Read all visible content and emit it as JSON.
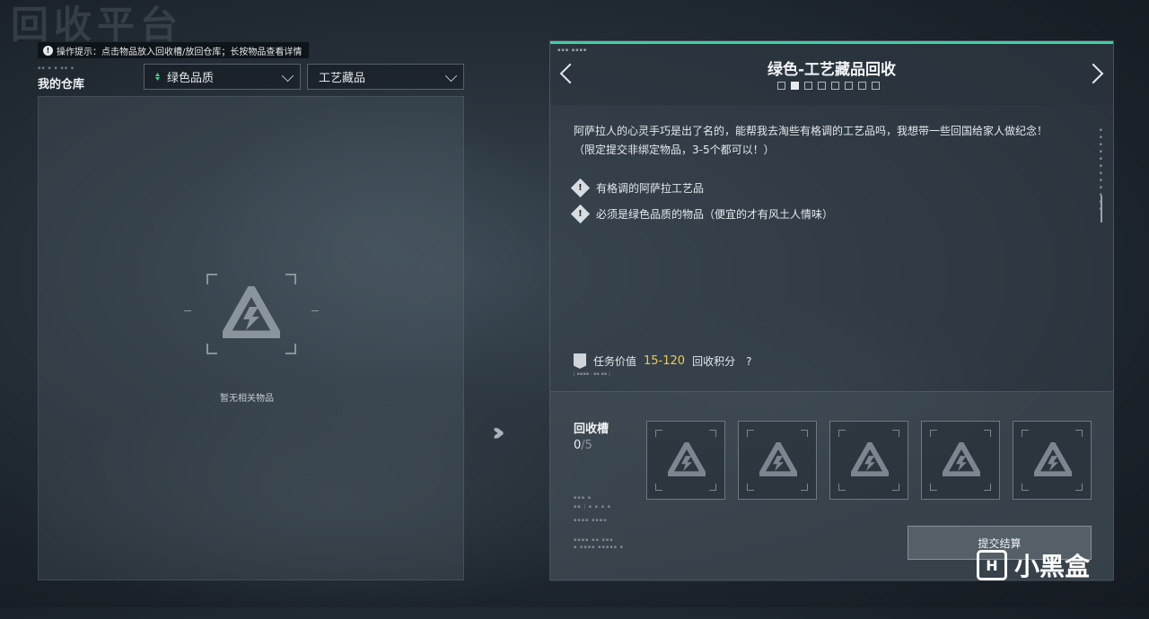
{
  "page_title": "回收平台",
  "hint": {
    "icon": "diamond-info-icon",
    "text": "操作提示：点击物品放入回收槽/放回仓库；长按物品查看详情"
  },
  "warehouse": {
    "title": "我的仓库",
    "empty_text": "暂无相关物品",
    "filter_quality": "绿色品质",
    "filter_category": "工艺藏品"
  },
  "quest": {
    "title": "绿色-工艺藏品回收",
    "description_line1": "阿萨拉人的心灵手巧是出了名的，能帮我去淘些有格调的工艺品吗，我想带一些回国给家人做纪念！",
    "description_line2": "（限定提交非绑定物品，3-5个都可以！）",
    "requirements": [
      "有格调的阿萨拉工艺品",
      "必须是绿色品质的物品（便宜的才有风土人情味）"
    ],
    "value_label": "任务价值",
    "value_range": "15-120",
    "value_unit": "回收积分",
    "help_symbol": "?",
    "pages_total": 8,
    "active_page": 2
  },
  "recycle_slots": {
    "title": "回收槽",
    "current": "0",
    "max": "/5",
    "slot_count": 5
  },
  "submit_label": "提交结算",
  "watermark": {
    "logo": "H",
    "text": "小黑盒"
  },
  "colors": {
    "accent": "#3fd0a3",
    "value": "#f0c84a",
    "quality_green": "#3fd18a"
  }
}
